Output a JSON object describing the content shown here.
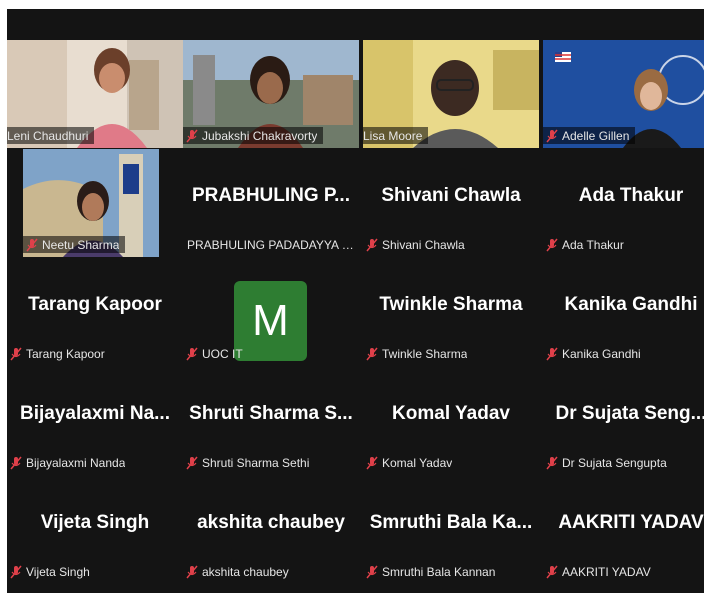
{
  "participants": [
    {
      "name": "Leni Chaudhuri"
    },
    {
      "name": "Jubakshi Chakravorty"
    },
    {
      "name": "Lisa Moore"
    },
    {
      "name": "Adelle Gillen"
    },
    {
      "name": "Neetu Sharma"
    },
    {
      "name": "PRABHULING PADADAYYA CHA...",
      "display": "PRABHULING P..."
    },
    {
      "name": "Shivani Chawla",
      "display": "Shivani Chawla"
    },
    {
      "name": "Ada Thakur",
      "display": "Ada Thakur"
    },
    {
      "name": "Tarang Kapoor",
      "display": "Tarang Kapoor"
    },
    {
      "name": "UOC IT",
      "avatar": "M"
    },
    {
      "name": "Twinkle Sharma",
      "display": "Twinkle Sharma"
    },
    {
      "name": "Kanika Gandhi",
      "display": "Kanika Gandhi"
    },
    {
      "name": "Bijayalaxmi Nanda",
      "display": "Bijayalaxmi Na..."
    },
    {
      "name": "Shruti Sharma Sethi",
      "display": "Shruti Sharma S..."
    },
    {
      "name": "Komal Yadav",
      "display": "Komal Yadav"
    },
    {
      "name": "Dr Sujata Sengupta",
      "display": "Dr Sujata Seng..."
    },
    {
      "name": "Vijeta Singh",
      "display": "Vijeta Singh"
    },
    {
      "name": "akshita chaubey",
      "display": "akshita chaubey"
    },
    {
      "name": "Smruthi Bala Kannan",
      "display": "Smruthi Bala Ka..."
    },
    {
      "name": "AAKRITI YADAV",
      "display": "AAKRITI YADAV"
    }
  ],
  "colors": {
    "background": "#141414",
    "mic_muted": "#e0404a",
    "active_speaker_border": "#3dd68c",
    "avatar_bg": "#2e7d32"
  },
  "icons": {
    "muted": "mic-muted-icon"
  }
}
